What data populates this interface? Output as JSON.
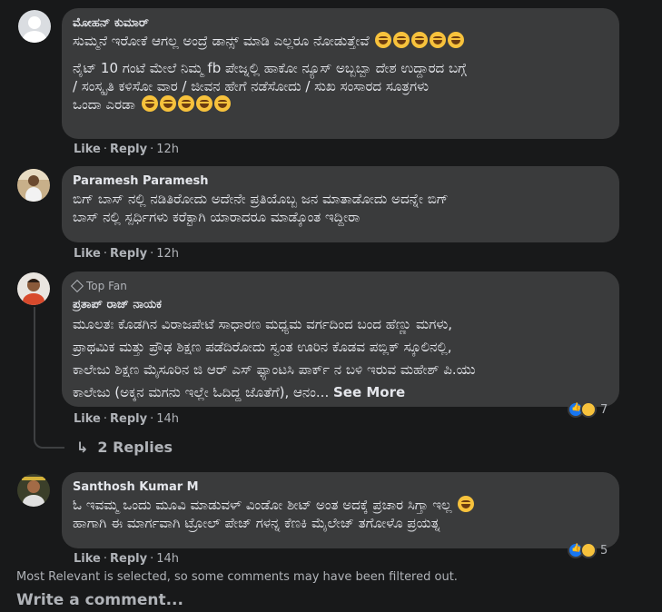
{
  "comments": [
    {
      "author": "ಮೋಹನ್ ಕುಮಾರ್",
      "paragraphs": [
        "ಸುಮ್ಮನೆ ಇರೋಕೆ ಆಗಲ್ಲ ಅಂದ್ರೆ ಡಾನ್ಸ್ ಮಾಡಿ ಎಲ್ಲರೂ ನೋಡುತ್ತೇವೆ",
        "ನೈಟ್ 10 ಗಂಟೆ ಮೇಲೆ ನಿಮ್ಮ fb ಪೇಜ್ನಲ್ಲಿ ಹಾಕೋ ನ್ಯೂಸ್ ಅಬ್ಬಬ್ಬಾ ದೇಶ ಉದ್ದಾರದ ಬಗ್ಗೆ",
        "/ ಸಂಸ್ಕೃತಿ ಕಳಿಸೋ ವಾರ / ಜೀವನ ಹೇಗೆ ನಡೆಸೋದು / ಸುಖ ಸಂಸಾರದ ಸೂತ್ರಗಳು",
        "ಒಂದಾ ಎರಡಾ"
      ],
      "like": "Like",
      "reply": "Reply",
      "time": "12h"
    },
    {
      "author": "Paramesh Paramesh",
      "paragraphs": [
        "ಬಿಗ್ ಬಾಸ್ ನಲ್ಲಿ ನಡಿತಿರೋದು ಅದೇನೇ ಪ್ರತಿಯೊಬ್ಬ ಜನ ಮಾತಾಡೋದು ಅದನ್ನೇ ಬಿಗ್",
        "ಬಾಸ್ ನಲ್ಲಿ ಸ್ಪರ್ಧಿಗಳು ಕರೆಕ್ಟಾಗಿ ಯಾರಾದರೂ ಮಾಡ್ಕೊಂತ ಇದ್ದೀರಾ"
      ],
      "like": "Like",
      "reply": "Reply",
      "time": "12h"
    },
    {
      "badge": "Top Fan",
      "author": "ಪ್ರತಾಪ್ ರಾಜ್ ನಾಯಕ",
      "paragraphs": [
        "ಮೂಲತಃ ಕೊಡಗಿನ ವಿರಾಜಪೇಟೆ ಸಾಧಾರಣ ಮಧ್ಯಮ ವರ್ಗದಿಂದ ಬಂದ ಹೆಣ್ಣು ಮಗಳು,",
        "ಪ್ರಾಥಮಿಕ ಮತ್ತು ಪ್ರೌಢ ಶಿಕ್ಷಣ ಪಡೆದಿರೋದು ಸ್ವಂತ ಊರಿನ ಕೊಡವ ಪಬ್ಲಿಕ್ ಸ್ಕೂಲಿನಲ್ಲಿ,",
        "ಕಾಲೇಜು ಶಿಕ್ಷಣ ಮೈಸೂರಿನ ಜಿ ಆರ್ ಎಸ್ ಫ್ಯಾಂಟಸಿ ಪಾರ್ಕ್ ನ ಬಳಿ ಇರುವ ಮಹೇಶ್ ಪಿ.ಯು",
        "ಕಾಲೇಜು (ಅಕ್ಕನ ಮಗನು ಇಲ್ಲೇ ಓದಿದ್ದ ಜೊತೆಗೆ), ಆನಂ..."
      ],
      "see_more": "See More",
      "reaction_count": "7",
      "like": "Like",
      "reply": "Reply",
      "time": "14h",
      "replies_label": "2 Replies"
    },
    {
      "author": "Santhosh Kumar M",
      "paragraphs": [
        "ಓ ಇವಮ್ಮ ಒಂದು ಮೂವಿ ಮಾಡುವಳ್ ವಿಂಡೋ ಶೀಟ್ ಅಂತ ಅದಕ್ಕೆ ಪ್ರಚಾರ ಸಿಗ್ತಾ ಇಲ್ಲ",
        "ಹಾಗಾಗಿ ಈ ಮಾರ್ಗವಾಗಿ ಟ್ರೋಲ್ ಪೇಜ್ ಗಳನ್ನ ಕೆಣಕಿ ಮೈಲೇಜ್ ತಗೋಳೊ ಪ್ರಯತ್ನ"
      ],
      "reaction_count": "5",
      "like": "Like",
      "reply": "Reply",
      "time": "14h"
    }
  ],
  "footer": {
    "filter_note": "Most Relevant is selected, so some comments may have been filtered out.",
    "write_comment": "Write a comment..."
  },
  "colors": {
    "background": "#18191a",
    "bubble": "#3a3b3c",
    "text": "#e4e6eb",
    "muted": "#b0b3b8",
    "like_blue": "#1877f2",
    "haha_yellow": "#f7c23c"
  }
}
